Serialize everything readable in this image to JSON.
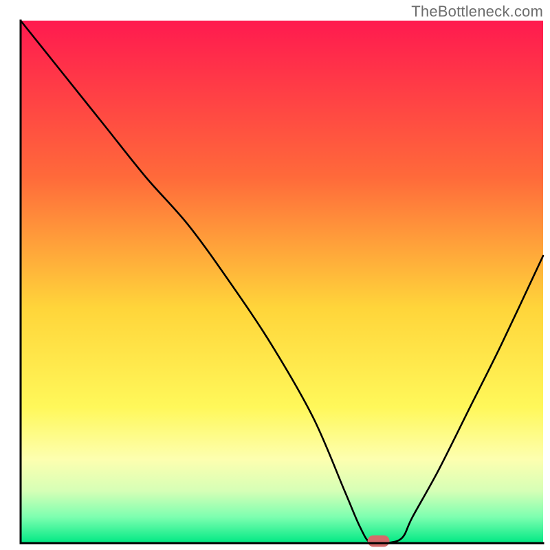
{
  "watermark": "TheBottleneck.com",
  "chart_data": {
    "type": "line",
    "title": "",
    "xlabel": "",
    "ylabel": "",
    "xlim": [
      0,
      100
    ],
    "ylim": [
      0,
      100
    ],
    "background": {
      "gradient_stops": [
        {
          "offset": 0,
          "color": "#ff1a4f"
        },
        {
          "offset": 30,
          "color": "#ff6a3a"
        },
        {
          "offset": 55,
          "color": "#ffd53a"
        },
        {
          "offset": 74,
          "color": "#fff85a"
        },
        {
          "offset": 84,
          "color": "#fdffb0"
        },
        {
          "offset": 90,
          "color": "#d6ffb6"
        },
        {
          "offset": 95,
          "color": "#7dffb0"
        },
        {
          "offset": 100,
          "color": "#00e884"
        }
      ]
    },
    "series": [
      {
        "name": "bottleneck-curve",
        "x": [
          0,
          8,
          16,
          24,
          32,
          40,
          48,
          56,
          62,
          65,
          67,
          70,
          73,
          75,
          80,
          86,
          92,
          100
        ],
        "y": [
          100,
          90,
          80,
          70,
          61,
          50,
          38,
          24,
          10,
          3,
          0,
          0,
          1,
          5,
          14,
          26,
          38,
          55
        ]
      }
    ],
    "marker": {
      "name": "optimal-point",
      "x": 68.5,
      "y": 0,
      "color": "#d46a6a",
      "width": 4.2,
      "height": 2.2
    },
    "axes_color": "#000000",
    "axes_width": 3
  }
}
